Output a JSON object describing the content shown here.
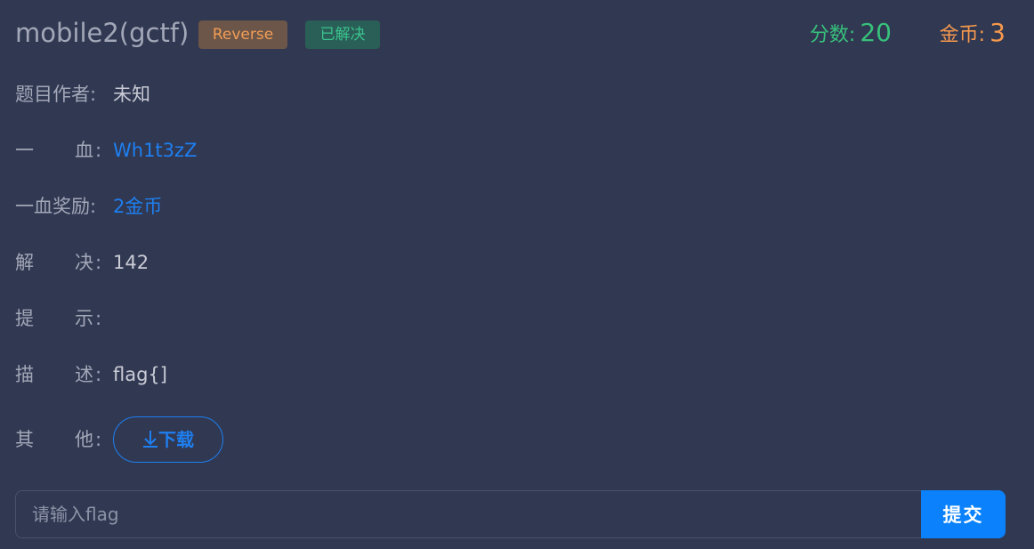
{
  "challenge": {
    "title": "mobile2(gctf)",
    "category": "Reverse",
    "status": "已解决",
    "score_label": "分数:",
    "score_value": "20",
    "coins_label": "金币:",
    "coins_value": "3"
  },
  "details": {
    "author": {
      "label": "题目作者:",
      "value": "未知"
    },
    "first_blood": {
      "label_1": "一",
      "label_2": "血",
      "colon": ":",
      "value": "Wh1t3zZ"
    },
    "first_blood_reward": {
      "label": "一血奖励:",
      "value": "2金币"
    },
    "solved": {
      "label_1": "解",
      "label_2": "决",
      "colon": ":",
      "value": "142"
    },
    "hint": {
      "label_1": "提",
      "label_2": "示",
      "colon": ":",
      "value": ""
    },
    "description": {
      "label_1": "描",
      "label_2": "述",
      "colon": ":",
      "value": "flag{]"
    },
    "other": {
      "label_1": "其",
      "label_2": "他",
      "colon": ":",
      "download_label": "下载"
    }
  },
  "flag_form": {
    "placeholder": "请输入flag",
    "value": "",
    "submit_label": "提交"
  },
  "colors": {
    "background": "#313852",
    "category_badge": "#6c5649",
    "status_badge": "#2a5f57",
    "score": "#37c17b",
    "coins": "#f6994d",
    "link": "#1e7ff0",
    "submit": "#0b82fb"
  },
  "icons": {
    "download": "download-arrow-icon"
  }
}
